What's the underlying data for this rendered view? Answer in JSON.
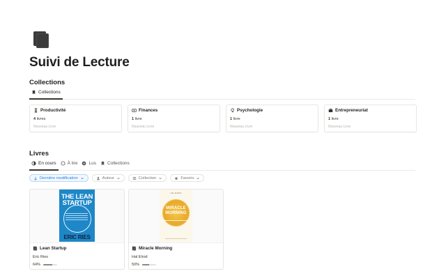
{
  "page": {
    "icon": "book-icon",
    "title": "Suivi de Lecture"
  },
  "collections_section": {
    "title": "Collections",
    "tabs": [
      {
        "label": "Collections",
        "icon": "bookmark-icon",
        "active": true
      }
    ],
    "cards": [
      {
        "name": "Productivité",
        "icon": "hourglass-icon",
        "count": "4",
        "unit": "livres",
        "button": "Nouveau Livre"
      },
      {
        "name": "Finances",
        "icon": "money-icon",
        "count": "1",
        "unit": "livre",
        "button": "Nouveau Livre"
      },
      {
        "name": "Psychologie",
        "icon": "brain-icon",
        "count": "1",
        "unit": "livre",
        "button": "Nouveau Livre"
      },
      {
        "name": "Entrepreneuriat",
        "icon": "briefcase-icon",
        "count": "1",
        "unit": "livre",
        "button": "Nouveau Livre"
      }
    ]
  },
  "books_section": {
    "title": "Livres",
    "tabs": [
      {
        "label": "En cours",
        "icon": "progress-icon",
        "active": true
      },
      {
        "label": "À lire",
        "icon": "circle-icon",
        "active": false
      },
      {
        "label": "Lus",
        "icon": "check-circle-icon",
        "active": false
      },
      {
        "label": "Collections",
        "icon": "bookmark-icon",
        "active": false
      }
    ],
    "filters": [
      {
        "label": "Dernière modification",
        "icon": "sort-icon",
        "active": true
      },
      {
        "label": "Auteur",
        "icon": "person-icon",
        "active": false
      },
      {
        "label": "Collection",
        "icon": "list-icon",
        "active": false
      },
      {
        "label": "Favoris",
        "icon": "star-icon",
        "active": false
      }
    ],
    "books": [
      {
        "title": "Lean Startup",
        "author": "Eric Ries",
        "progress_label": "64%",
        "progress": 0.64,
        "cover": {
          "line1": "THE LEAN",
          "line2": "STARTUP",
          "author": "ERIC RIES",
          "color": "#1d87c8"
        }
      },
      {
        "title": "Miracle Morning",
        "author": "Hal Elrod",
        "progress_label": "50%",
        "progress": 0.5,
        "cover": {
          "line1": "MIRACLE",
          "line2": "MORNING",
          "top": "HAL ELROD",
          "color": "#e9a92a"
        }
      }
    ]
  },
  "colors": {
    "accent": "#2383e2",
    "text": "#37352f",
    "border": "#e6e6e4"
  }
}
